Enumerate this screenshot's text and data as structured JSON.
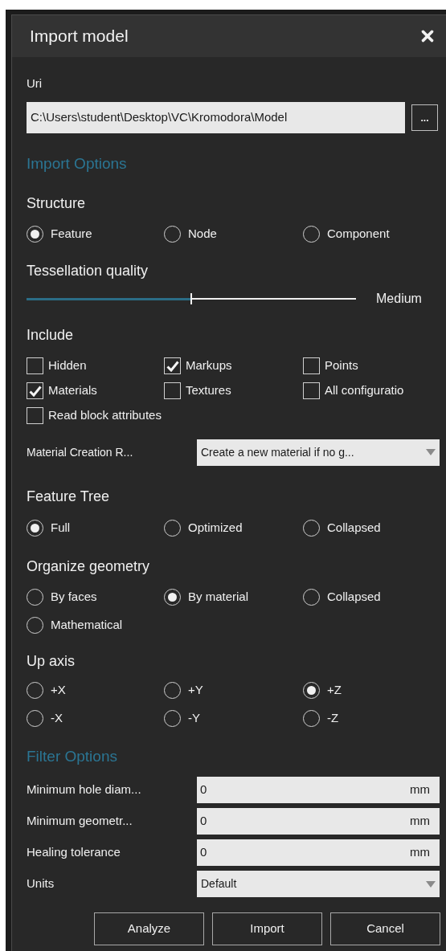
{
  "title": "Import model",
  "uri": {
    "label": "Uri",
    "value": "C:\\Users\\student\\Desktop\\VC\\Kromodora\\Model",
    "browse": "..."
  },
  "import_options": {
    "heading": "Import Options",
    "structure": {
      "label": "Structure",
      "options": [
        {
          "label": "Feature",
          "selected": true
        },
        {
          "label": "Node",
          "selected": false
        },
        {
          "label": "Component",
          "selected": false
        }
      ]
    },
    "tessellation": {
      "label": "Tessellation quality",
      "level": 0.5,
      "reading": "Medium"
    },
    "include": {
      "label": "Include",
      "items": [
        {
          "label": "Hidden",
          "checked": false
        },
        {
          "label": "Markups",
          "checked": true
        },
        {
          "label": "Points",
          "checked": false
        },
        {
          "label": "Materials",
          "checked": true
        },
        {
          "label": "Textures",
          "checked": false
        },
        {
          "label": "All configuratio",
          "checked": false
        },
        {
          "label": "Read block attributes",
          "checked": false
        }
      ]
    },
    "material_creation": {
      "label": "Material Creation R...",
      "value": "Create a new material if no g..."
    },
    "feature_tree": {
      "label": "Feature Tree",
      "options": [
        {
          "label": "Full",
          "selected": true
        },
        {
          "label": "Optimized",
          "selected": false
        },
        {
          "label": "Collapsed",
          "selected": false
        }
      ]
    },
    "organize_geometry": {
      "label": "Organize geometry",
      "options": [
        {
          "label": "By faces",
          "selected": false
        },
        {
          "label": "By material",
          "selected": true
        },
        {
          "label": "Collapsed",
          "selected": false
        },
        {
          "label": "Mathematical",
          "selected": false
        }
      ]
    },
    "up_axis": {
      "label": "Up axis",
      "options": [
        {
          "label": "+X",
          "selected": false
        },
        {
          "label": "+Y",
          "selected": false
        },
        {
          "label": "+Z",
          "selected": true
        },
        {
          "label": "-X",
          "selected": false
        },
        {
          "label": "-Y",
          "selected": false
        },
        {
          "label": "-Z",
          "selected": false
        }
      ]
    }
  },
  "filter_options": {
    "heading": "Filter Options",
    "fields": [
      {
        "label": "Minimum hole diam...",
        "value": "0",
        "unit": "mm"
      },
      {
        "label": "Minimum geometr...",
        "value": "0",
        "unit": "mm"
      },
      {
        "label": "Healing tolerance",
        "value": "0",
        "unit": "mm"
      }
    ],
    "units": {
      "label": "Units",
      "value": "Default"
    }
  },
  "buttons": [
    "Analyze",
    "Import",
    "Cancel"
  ]
}
